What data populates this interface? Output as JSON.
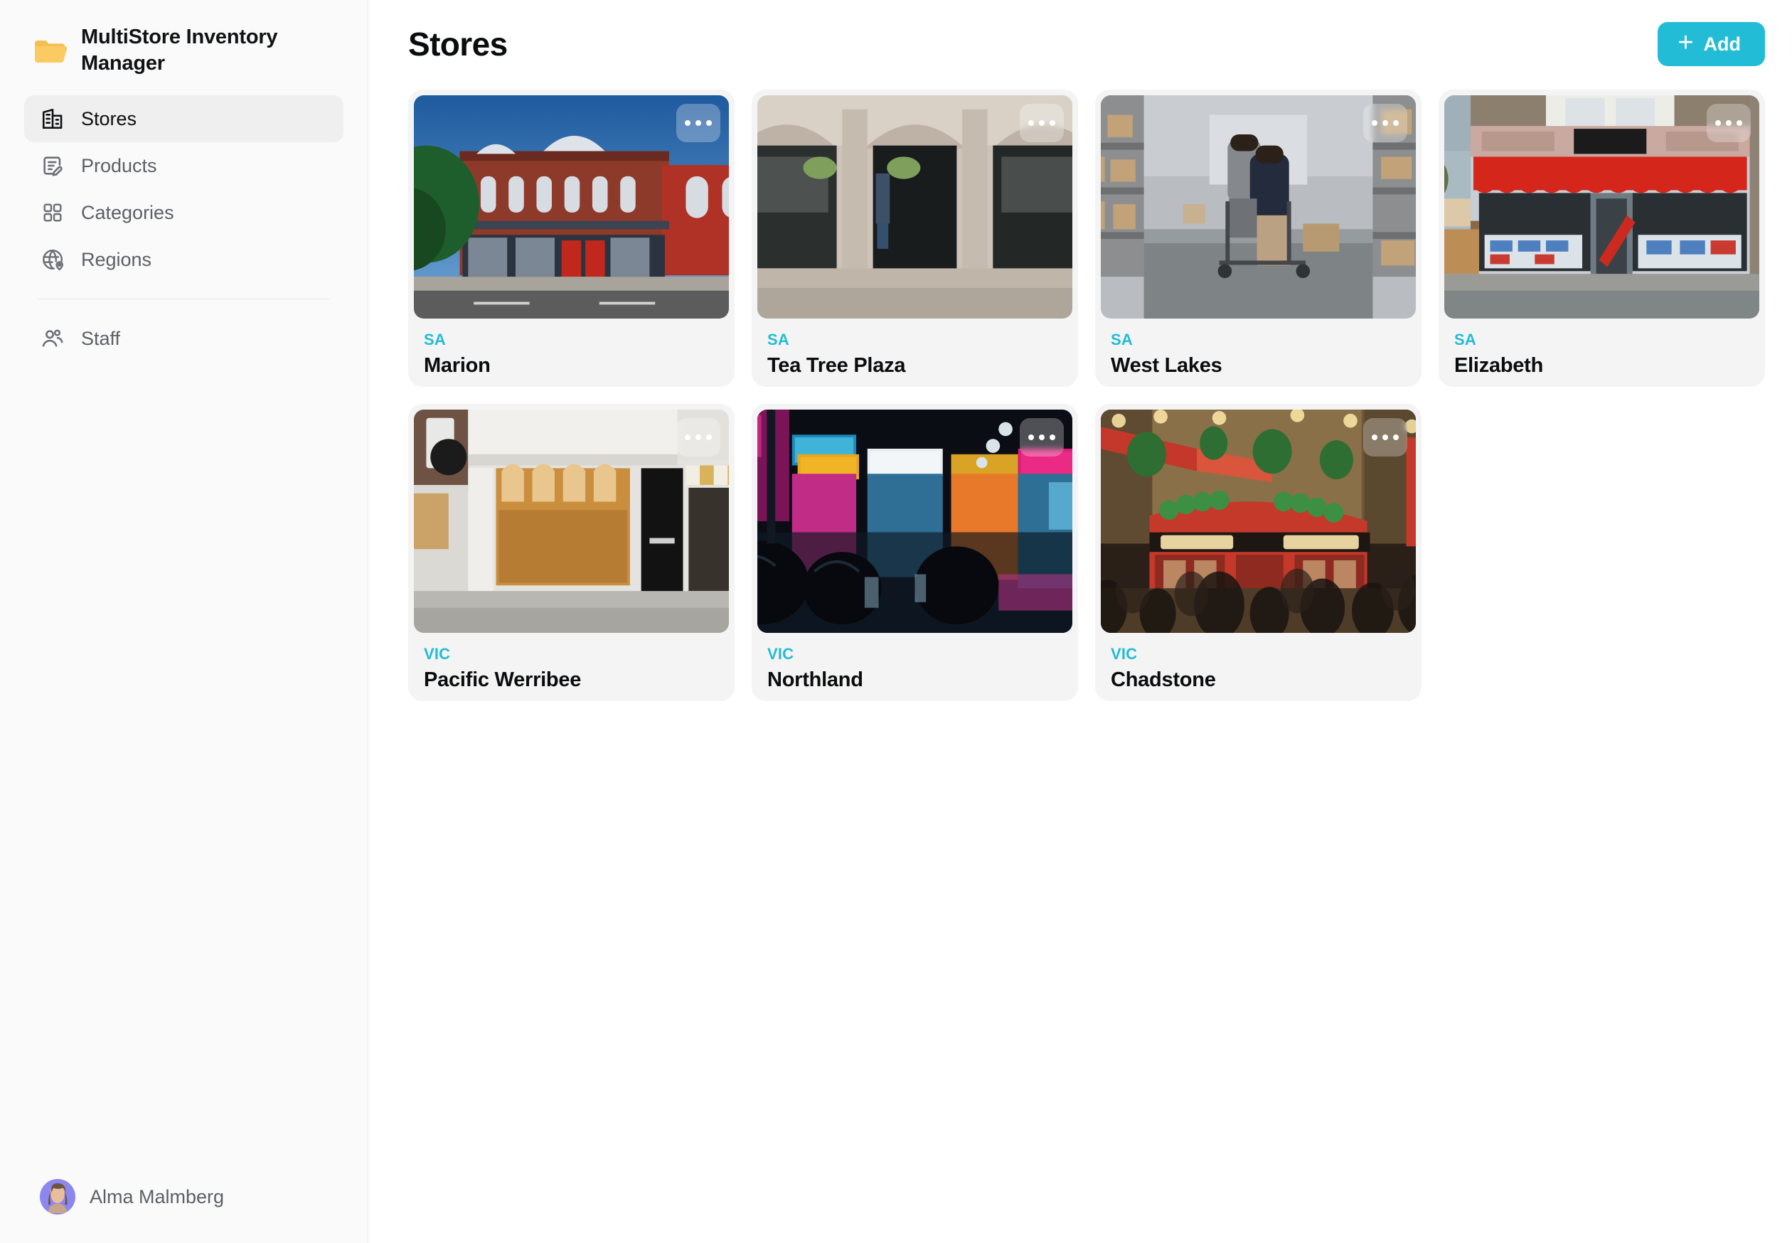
{
  "app": {
    "brand_title": "MultiStore Inventory Manager",
    "brand_icon": "open-folder-icon"
  },
  "sidebar": {
    "items": [
      {
        "label": "Stores",
        "icon": "building-icon",
        "active": true
      },
      {
        "label": "Products",
        "icon": "document-edit-icon",
        "active": false
      },
      {
        "label": "Categories",
        "icon": "grid-squares-icon",
        "active": false
      },
      {
        "label": "Regions",
        "icon": "globe-pin-icon",
        "active": false
      }
    ],
    "secondary_items": [
      {
        "label": "Staff",
        "icon": "users-icon",
        "active": false
      }
    ],
    "user": {
      "name": "Alma Malmberg",
      "avatar_bg": "#8B87EE"
    }
  },
  "header": {
    "title": "Stores",
    "add_label": "Add",
    "add_icon": "plus-icon",
    "accent_color": "#22BCD6"
  },
  "main": {
    "card_menu_icon": "ellipsis-icon",
    "stores": [
      {
        "region": "SA",
        "name": "Marion",
        "photo": "brick-storefront-street"
      },
      {
        "region": "SA",
        "name": "Tea Tree Plaza",
        "photo": "stone-arched-shopfront"
      },
      {
        "region": "SA",
        "name": "West Lakes",
        "photo": "warehouse-aisle"
      },
      {
        "region": "SA",
        "name": "Elizabeth",
        "photo": "newsagent-red-awning"
      },
      {
        "region": "VIC",
        "name": "Pacific Werribee",
        "photo": "white-barts-shopfront"
      },
      {
        "region": "VIC",
        "name": "Northland",
        "photo": "neon-night-street"
      },
      {
        "region": "VIC",
        "name": "Chadstone",
        "photo": "temple-bar-pub-crowd"
      }
    ]
  },
  "colors": {
    "accent": "#22BCD6",
    "card_bg": "#F4F4F4",
    "sidebar_bg": "#FAFAFA",
    "active_nav_bg": "#EFEFEF",
    "text_primary": "#0B0C0E",
    "text_muted": "#5C5F66"
  }
}
